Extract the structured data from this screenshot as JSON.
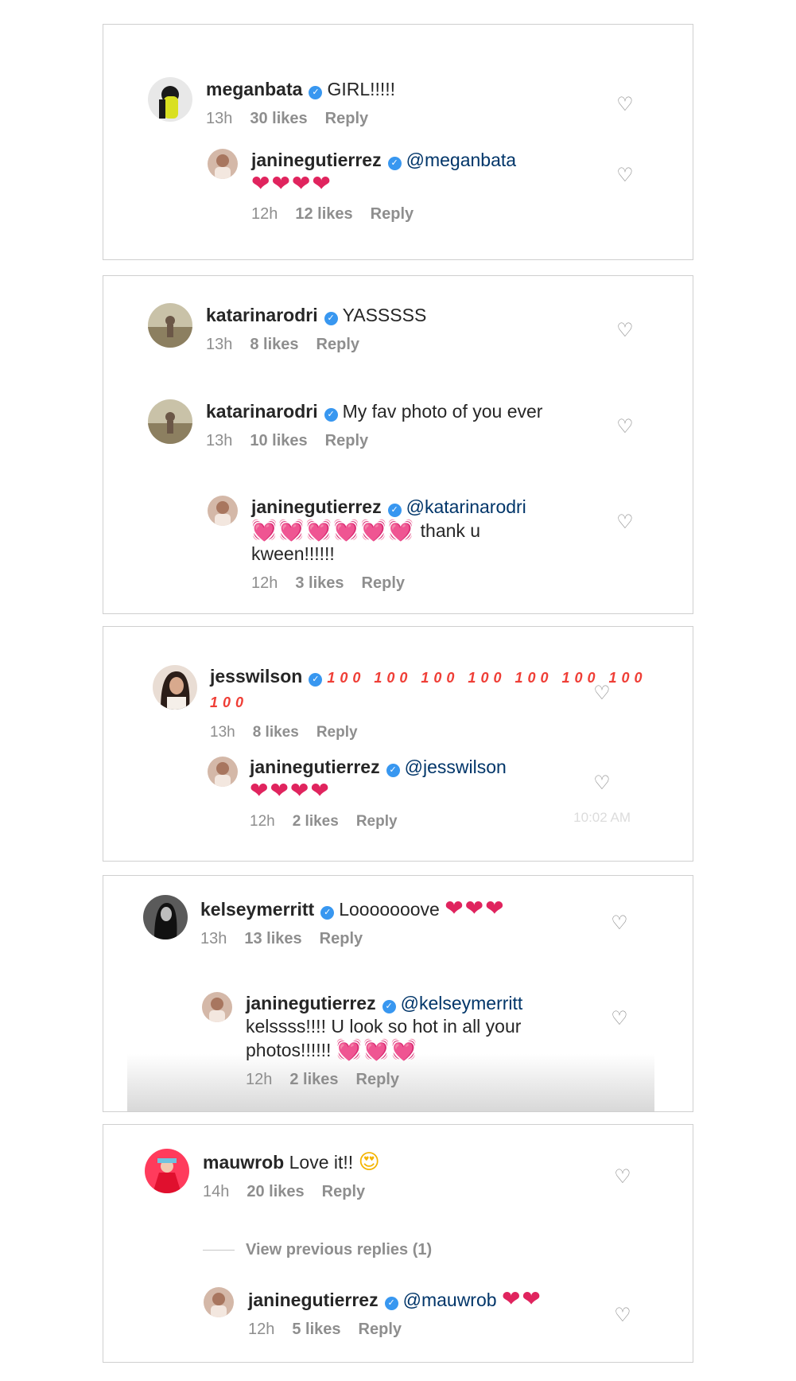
{
  "colors": {
    "verified": "#3897f0",
    "mention": "#003569",
    "meta": "#8e8e8e",
    "heart_red": "#e0245e",
    "heart_pink": "#ff4fa3"
  },
  "icons": {
    "like": "heart-outline-icon",
    "verified": "verified-badge-icon"
  },
  "threads": [
    {
      "comments": [
        {
          "username": "meganbata",
          "text": "GIRL!!!!!",
          "time": "13h",
          "likes": "30 likes",
          "reply": "Reply"
        },
        {
          "username": "janinegutierrez",
          "mention": "@meganbata",
          "emoji": "❤❤❤❤",
          "time": "12h",
          "likes": "12 likes",
          "reply": "Reply"
        }
      ]
    },
    {
      "comments": [
        {
          "username": "katarinarodri",
          "text": "YASSSSS",
          "time": "13h",
          "likes": "8 likes",
          "reply": "Reply"
        },
        {
          "username": "katarinarodri",
          "text": "My fav photo of you ever",
          "time": "13h",
          "likes": "10 likes",
          "reply": "Reply"
        },
        {
          "username": "janinegutierrez",
          "mention": "@katarinarodri",
          "emoji": "💓💓💓💓💓💓",
          "text": "thank u",
          "text2": "kween!!!!!!",
          "time": "12h",
          "likes": "3 likes",
          "reply": "Reply"
        }
      ]
    },
    {
      "comments": [
        {
          "username": "jesswilson",
          "emoji": "100 100 100 100 100 100 100 100",
          "time": "13h",
          "likes": "8 likes",
          "reply": "Reply"
        },
        {
          "username": "janinegutierrez",
          "mention": "@jesswilson",
          "emoji": "❤❤❤❤",
          "time": "12h",
          "likes": "2 likes",
          "reply": "Reply",
          "timestamp": "10:02 AM"
        }
      ]
    },
    {
      "comments": [
        {
          "username": "kelseymerritt",
          "text": "Looooooove",
          "emoji": "❤❤❤",
          "time": "13h",
          "likes": "13 likes",
          "reply": "Reply"
        },
        {
          "username": "janinegutierrez",
          "mention": "@kelseymerritt",
          "text": "kelssss!!!! U look so hot in all your",
          "text2": "photos!!!!!!",
          "emoji": "💓💓💓",
          "time": "12h",
          "likes": "2 likes",
          "reply": "Reply"
        }
      ]
    },
    {
      "comments": [
        {
          "username": "mauwrob",
          "text": "Love it!!",
          "emoji": "😍",
          "time": "14h",
          "likes": "20 likes",
          "reply": "Reply"
        },
        {
          "username": "janinegutierrez",
          "mention": "@mauwrob",
          "emoji": "❤❤",
          "time": "12h",
          "likes": "5 likes",
          "reply": "Reply"
        }
      ],
      "view_previous": "View previous replies (1)"
    }
  ]
}
